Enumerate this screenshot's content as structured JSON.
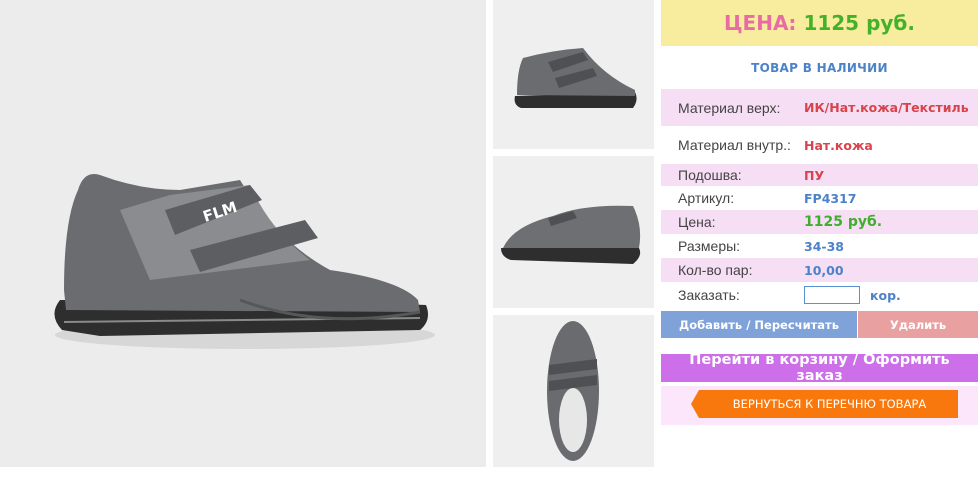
{
  "product": {
    "brand_mark": "FLM",
    "price_label": "ЦЕНА:",
    "price_value": "1125 руб.",
    "stock_status": "ТОВАР В НАЛИЧИИ"
  },
  "attributes": [
    {
      "label": "Материал верх:",
      "value": "ИК/Нат.кожа/Текстиль"
    },
    {
      "label": "Материал внутр.:",
      "value": "Нат.кожа"
    },
    {
      "label": "Подошва:",
      "value": "ПУ"
    },
    {
      "label": "Артикул:",
      "value": "FP4317"
    },
    {
      "label": "Цена:",
      "value": "1125 руб."
    },
    {
      "label": "Размеры:",
      "value": "34-38"
    },
    {
      "label": "Кол-во пар:",
      "value": "10,00"
    }
  ],
  "order": {
    "label": "Заказать:",
    "quantity_value": "",
    "unit": "кор."
  },
  "buttons": {
    "add_recalc": "Добавить / Пересчитать",
    "delete": "Удалить",
    "cart_checkout": "Перейти в корзину / Оформить заказ",
    "back_to_list": "ВЕРНУТЬСЯ К ПЕРЕЧНЮ ТОВАРА"
  },
  "colors": {
    "price_label": "#e76ca4",
    "price_value": "#44b12b",
    "accent_blue": "#4c82c9",
    "accent_red": "#d7444b",
    "cart_button": "#cc6fe8",
    "back_button": "#f9780e"
  }
}
